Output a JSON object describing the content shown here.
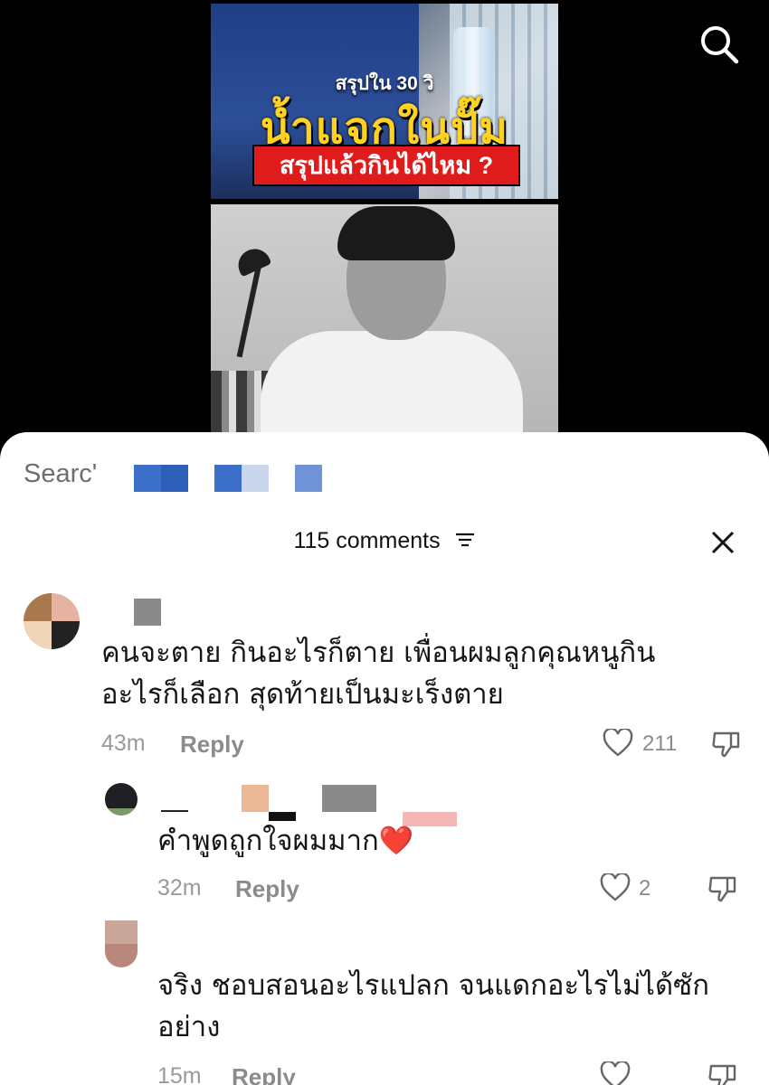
{
  "video": {
    "caption_small": "สรุปใน 30 วิ",
    "caption_big": "น้ำแจกในปั๊ม",
    "caption_banner": "สรุปแล้วกินได้ไหม ?",
    "search_icon": "search-icon"
  },
  "search": {
    "text": "Searc'"
  },
  "comments_header": {
    "title": "115 comments",
    "filter_icon": "filter-icon",
    "close_icon": "close-icon"
  },
  "comments": [
    {
      "text_line1": "คนจะตาย กินอะไรก็ตาย เพื่อนผมลูกคุณหนูกิน",
      "text_line2": "อะไรก็เลือก สุดท้ายเป็นมะเร็งตาย",
      "time": "43m",
      "reply_label": "Reply",
      "likes": "211"
    },
    {
      "text_line1": "คำพูดถูกใจผมมาก❤️",
      "time": "32m",
      "reply_label": "Reply",
      "likes": "2"
    },
    {
      "text_line1": "จริง ชอบสอนอะไรแปลก จนแดกอะไรไม่ได้ซัก",
      "text_line2": "อย่าง",
      "time": "15m",
      "reply_label": "Reply"
    }
  ],
  "colors": {
    "panel_bg": "#ffffff",
    "censor_blue": "#3b6fc9",
    "censor_gray": "#8a8a8a",
    "heart_red": "#e0242e"
  }
}
